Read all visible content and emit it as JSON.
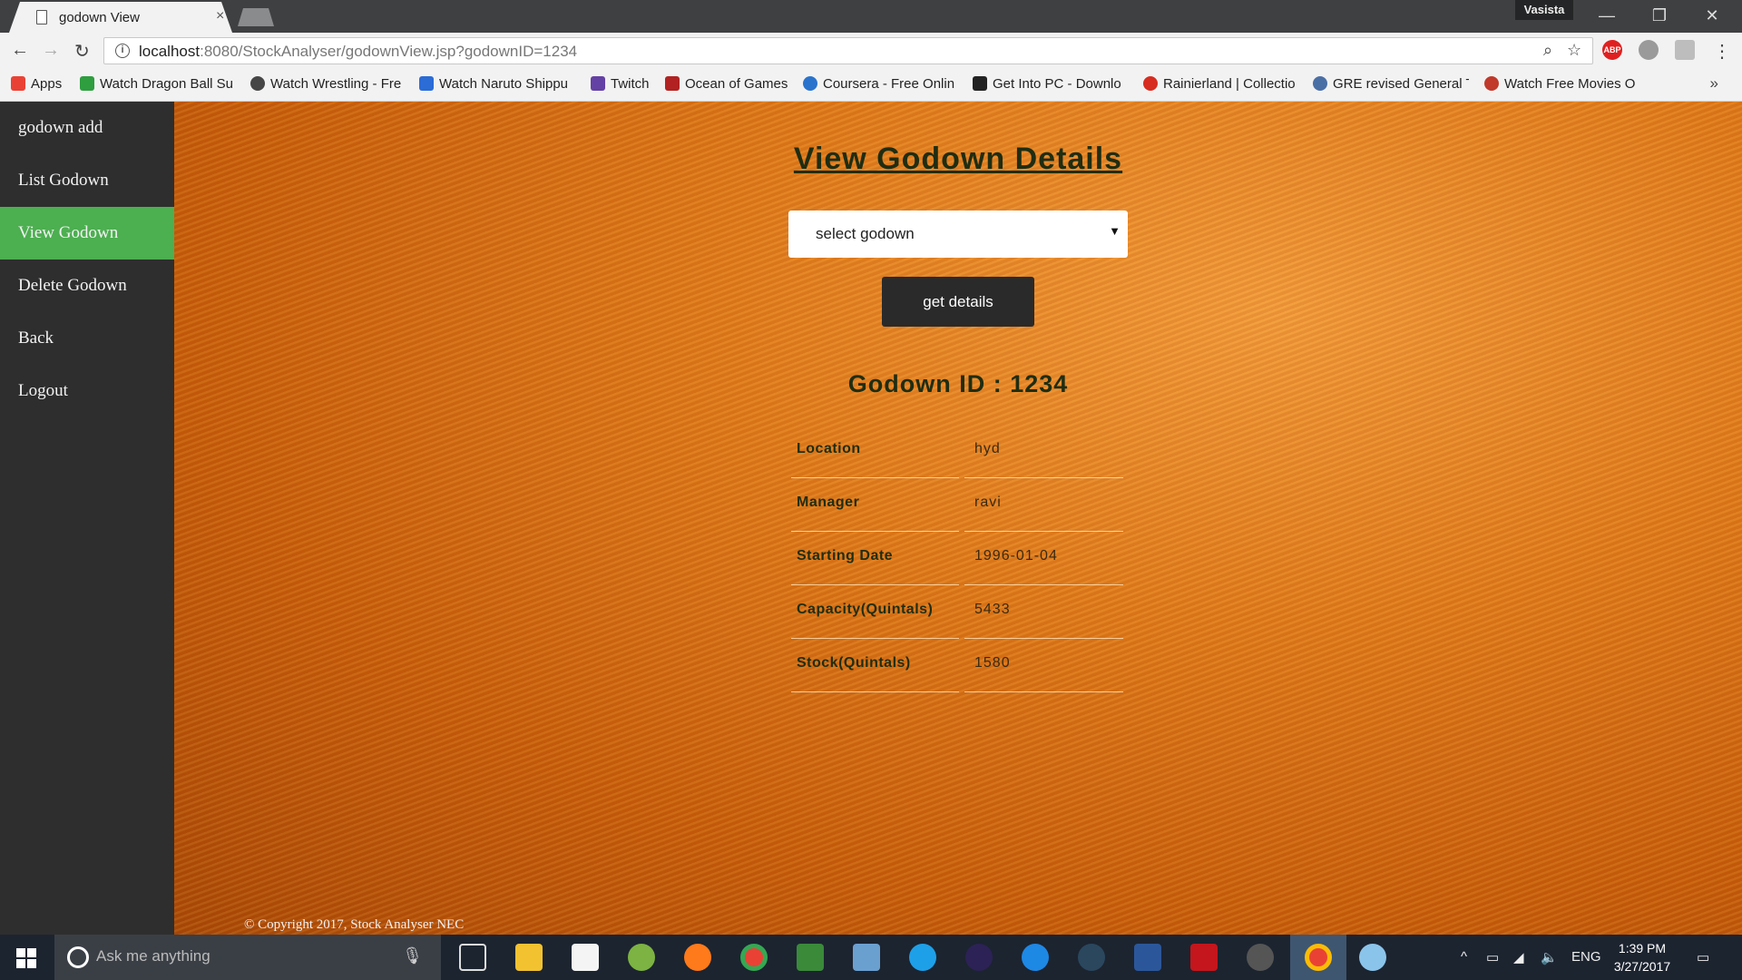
{
  "browser": {
    "tab_title": "godown View",
    "tab_close": "×",
    "profile_name": "Vasista",
    "window_buttons": [
      "—",
      "❐",
      "✕"
    ],
    "url_host": "localhost",
    "url_rest": ":8080/StockAnalyser/godownView.jsp?godownID=1234",
    "bookmarks": [
      {
        "label": "Apps",
        "color": "#e94235"
      },
      {
        "label": "Watch Dragon Ball Su",
        "color": "#2e9e3f"
      },
      {
        "label": "Watch Wrestling - Fre",
        "color": "#464646"
      },
      {
        "label": "Watch Naruto Shippu",
        "color": "#2b6cd6"
      },
      {
        "label": "Twitch",
        "color": "#6441a4"
      },
      {
        "label": "Ocean of Games",
        "color": "#b22222"
      },
      {
        "label": "Coursera - Free Onlin",
        "color": "#2a73cc"
      },
      {
        "label": "Get Into PC - Downlo",
        "color": "#222222"
      },
      {
        "label": "Rainierland | Collectio",
        "color": "#d62d20"
      },
      {
        "label": "GRE revised General T",
        "color": "#4a6fa5"
      },
      {
        "label": "Watch Free Movies O",
        "color": "#c0392b"
      }
    ],
    "bookmarks_more": "»"
  },
  "sidebar": {
    "items": [
      {
        "label": "godown add",
        "active": false
      },
      {
        "label": "List Godown",
        "active": false
      },
      {
        "label": "View Godown",
        "active": true
      },
      {
        "label": "Delete Godown",
        "active": false
      },
      {
        "label": "Back",
        "active": false
      },
      {
        "label": "Logout",
        "active": false
      }
    ],
    "active_color": "#4caf50"
  },
  "main": {
    "heading": "View Godown Details",
    "select_value": "select godown",
    "button_label": "get details",
    "godown_id_text": "Godown ID : 1234",
    "details": [
      {
        "key": "Location",
        "value": "hyd"
      },
      {
        "key": "Manager",
        "value": "ravi"
      },
      {
        "key": "Starting Date",
        "value": "1996-01-04"
      },
      {
        "key": "Capacity(Quintals)",
        "value": "5433"
      },
      {
        "key": "Stock(Quintals)",
        "value": "1580"
      }
    ],
    "copyright": "© Copyright 2017, Stock Analyser NEC"
  },
  "taskbar": {
    "search_placeholder": "Ask me anything",
    "language": "ENG",
    "time": "1:39 PM",
    "date": "3/27/2017",
    "app_icons": [
      "task-view",
      "file-explorer",
      "store",
      "android-studio",
      "firefox",
      "chrome",
      "excel-like",
      "visual-studio",
      "internet-explorer",
      "eclipse",
      "edge",
      "steam",
      "word",
      "acrobat",
      "settings",
      "chrome-active",
      "paint"
    ]
  }
}
